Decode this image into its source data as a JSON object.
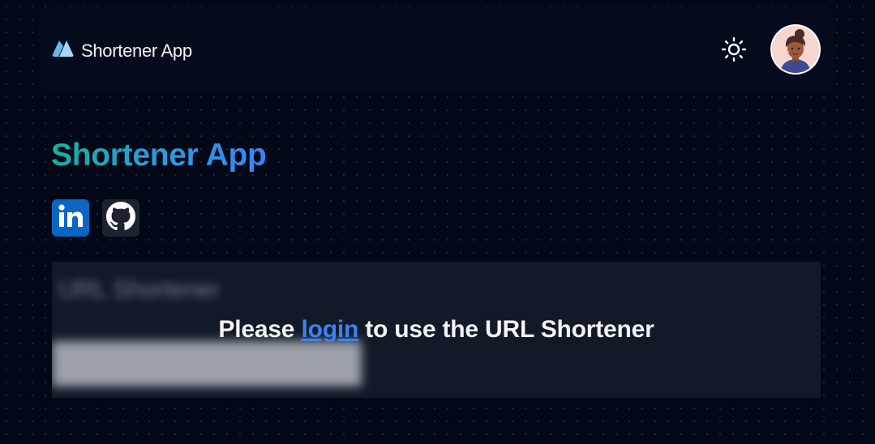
{
  "navbar": {
    "brand_name": "Shortener App",
    "logo_icon": "stacked-chevrons-icon",
    "theme_icon": "sun-icon",
    "avatar_icon": "user-avatar"
  },
  "main": {
    "title": "Shortener App",
    "title_gradient": [
      "#17b1a0",
      "#3b82f6"
    ],
    "socials": [
      {
        "name": "LinkedIn",
        "icon": "linkedin-icon",
        "color": "#0a66c2"
      },
      {
        "name": "GitHub",
        "icon": "github-icon",
        "color": "#1d2330"
      }
    ]
  },
  "panel": {
    "blurred_heading": "URL Shortener",
    "message_before": "Please ",
    "login_link": "login",
    "message_after": " to use the URL Shortener"
  },
  "colors": {
    "background": "#030817",
    "panel": "#121a28",
    "link": "#3b82f6"
  }
}
